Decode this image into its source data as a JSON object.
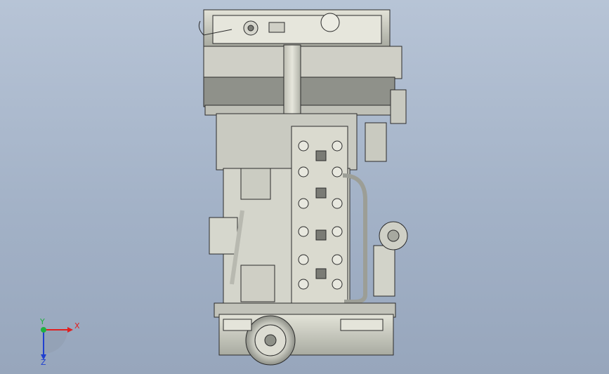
{
  "viewport": {
    "background_top": "#b7c4d6",
    "background_bottom": "#97a6bc"
  },
  "model": {
    "icon": "engine-3d-model",
    "body_color": "#d9d9cf",
    "shade_color": "#8f918a",
    "edge_color": "#2b2b2b"
  },
  "triad": {
    "x_label": "X",
    "y_label": "Y",
    "z_label": "Z",
    "x_color": "#e02020",
    "y_color": "#20b040",
    "z_color": "#2040d0"
  }
}
